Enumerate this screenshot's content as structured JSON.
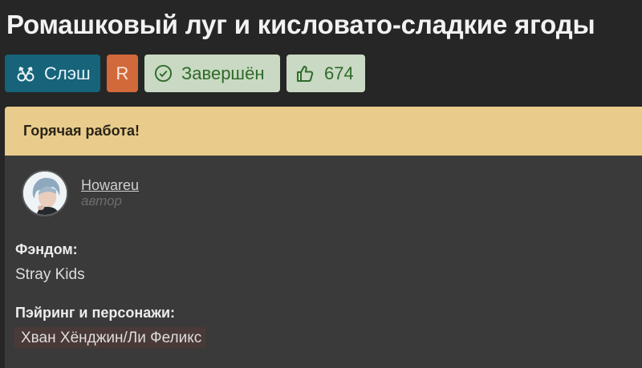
{
  "work": {
    "title": "Ромашковый луг и кисловато-сладкие ягоды"
  },
  "badges": {
    "direction": "Слэш",
    "rating": "R",
    "status": "Завершён",
    "likes": "674"
  },
  "banner": {
    "text": "Горячая работа!"
  },
  "author": {
    "name": "Howareu",
    "role": "автор"
  },
  "fandom": {
    "label": "Фэндом:",
    "value": "Stray Kids"
  },
  "pairing": {
    "label": "Пэйринг и персонажи:",
    "value": "Хван Хёнджин/Ли Феликс"
  },
  "colors": {
    "background": "#262626",
    "direction_badge": "#16637a",
    "rating_badge": "#d2693a",
    "status_badge": "#c9d9c3",
    "banner": "#e9cc8b",
    "card": "#3a3a3a"
  },
  "icons": {
    "direction": "slash-direction-icon",
    "status": "check-circle-icon",
    "likes": "thumbs-up-icon"
  }
}
